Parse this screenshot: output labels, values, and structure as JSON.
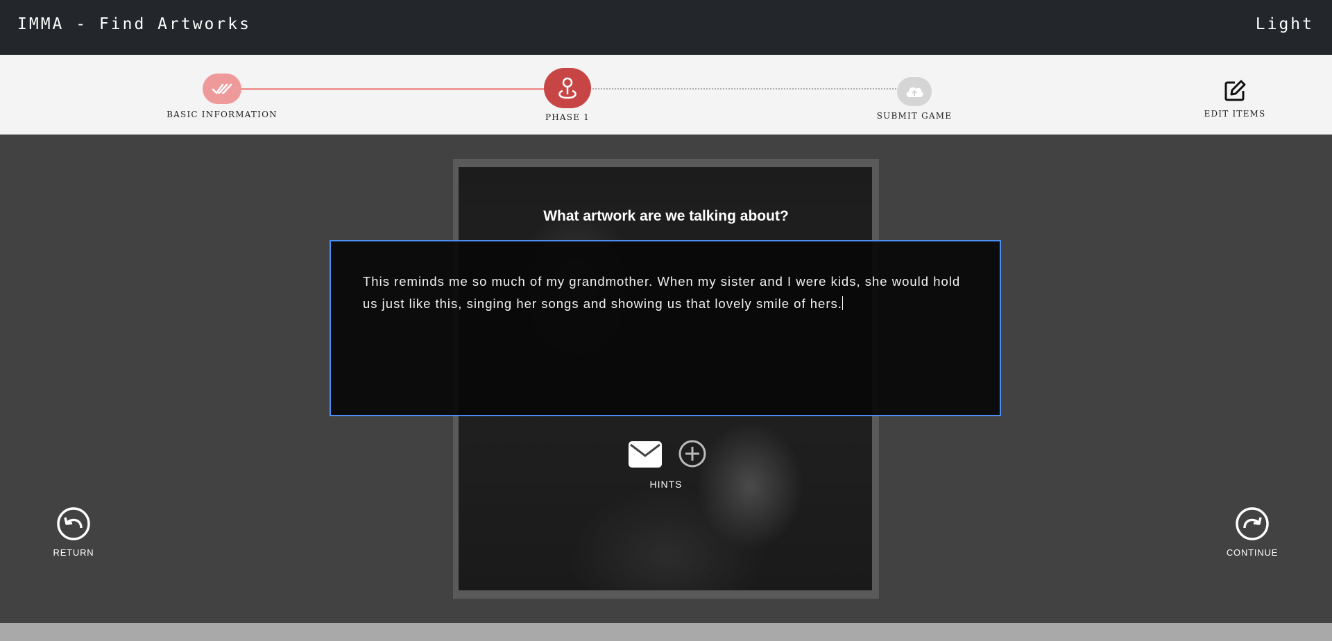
{
  "header": {
    "title": "IMMA - Find Artworks",
    "theme_toggle": "Light"
  },
  "stepper": {
    "steps": [
      {
        "label": "BASIC INFORMATION",
        "icon": "double-check-icon",
        "state": "done"
      },
      {
        "label": "PHASE 1",
        "icon": "map-pin-icon",
        "state": "current"
      },
      {
        "label": "SUBMIT GAME",
        "icon": "cloud-upload-icon",
        "state": "pending"
      }
    ],
    "edit_items": {
      "label": "EDIT ITEMS",
      "icon": "edit-icon"
    }
  },
  "main": {
    "question": "What artwork are we talking about?",
    "answer": "This reminds me so much of my grandmother. When my sister and I were kids, she would hold us just like this, singing her songs and showing us that lovely smile of hers.",
    "hints_label": "HINTS",
    "hint_icons": [
      "envelope-icon",
      "add-circle-icon"
    ]
  },
  "navigation": {
    "return_label": "RETURN",
    "continue_label": "CONTINUE"
  },
  "colors": {
    "topbar": "#23262b",
    "background": "#424242",
    "step_done": "#ef9a9a",
    "step_current": "#c84545",
    "step_pending": "#d5d5d5",
    "input_focus": "#4a8ff5"
  }
}
